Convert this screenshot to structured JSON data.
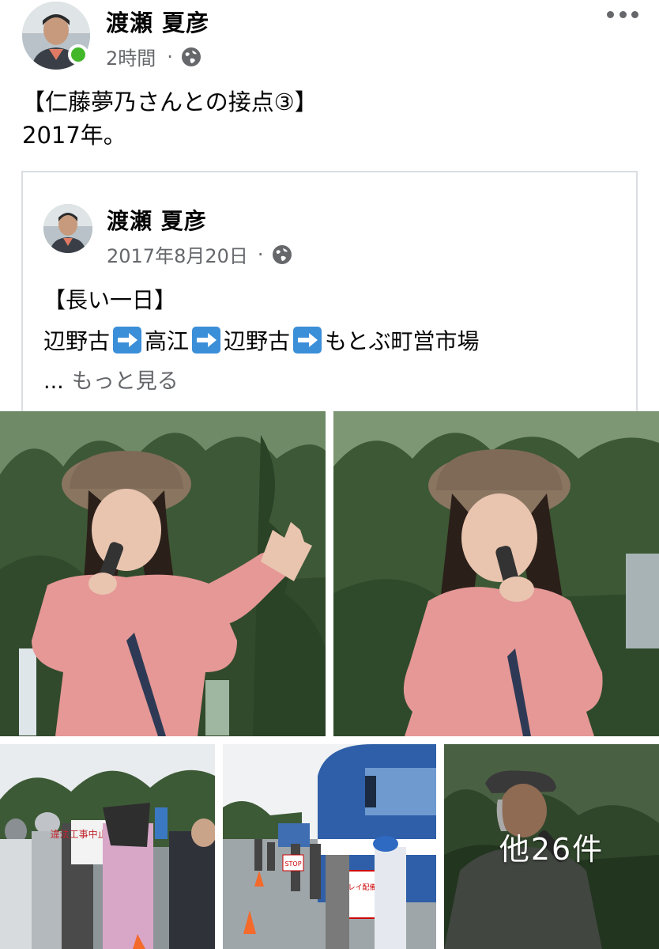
{
  "post": {
    "author": "渡瀬 夏彦",
    "timestamp": "2時間",
    "separator": "·",
    "privacy_icon": "globe-icon",
    "text_line1": "【仁藤夢乃さんとの接点③】",
    "text_line2": "2017年。"
  },
  "shared_post": {
    "author": "渡瀬 夏彦",
    "date": "2017年8月20日",
    "separator": "·",
    "title": "【長い一日】",
    "route": [
      "辺野古",
      "高江",
      "辺野古",
      "もとぶ町営市場"
    ],
    "ellipsis": "...",
    "see_more": "もっと見る"
  },
  "photos": {
    "more_count_label": "他26件",
    "sign_1": "違法工事中止せよ!",
    "sign_2": "STOP",
    "sign_3": "オスプレイ配備撤回"
  },
  "colors": {
    "online": "#42b72a",
    "meta_text": "#65676b",
    "arrow_emoji_bg": "#3b8ed8",
    "card_border": "#dadde1"
  }
}
